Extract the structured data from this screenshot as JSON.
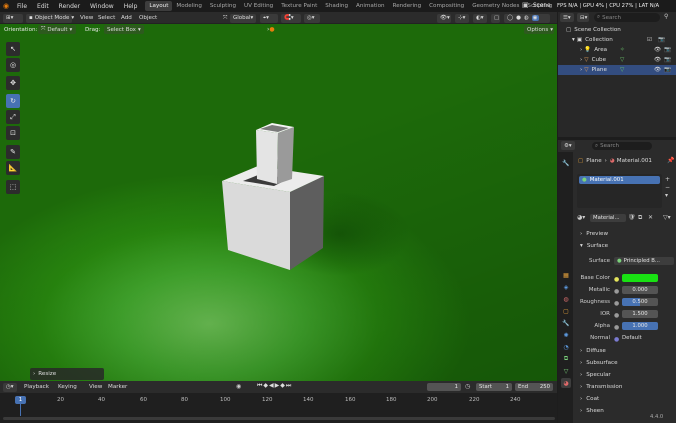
{
  "menu": [
    "File",
    "Edit",
    "Render",
    "Window",
    "Help"
  ],
  "workspaces": [
    "Layout",
    "Modeling",
    "Sculpting",
    "UV Editing",
    "Texture Paint",
    "Shading",
    "Animation",
    "Rendering",
    "Compositing",
    "Geometry Nodes",
    "Scripting"
  ],
  "active_workspace": "Layout",
  "scene_name": "Scene",
  "stats": "FPS N/A | GPU 4% | CPU 27% | LAT N/A",
  "header": {
    "mode": "Object Mode",
    "view": "View",
    "select": "Select",
    "add": "Add",
    "object": "Object",
    "transform": "Global"
  },
  "header2": {
    "orientation_label": "Orientation:",
    "orientation": "Default",
    "drag_label": "Drag:",
    "drag": "Select Box",
    "options": "Options"
  },
  "last_op": "Resize",
  "search_placeholder": "Search",
  "outliner": {
    "root": "Scene Collection",
    "collection": "Collection",
    "items": [
      {
        "name": "Area"
      },
      {
        "name": "Cube"
      },
      {
        "name": "Plane"
      }
    ]
  },
  "properties": {
    "search_placeholder": "Search",
    "breadcrumb_object": "Plane",
    "breadcrumb_material": "Material.001",
    "slot": "Material.001",
    "material_name": "Material...",
    "sections": [
      "Preview",
      "Surface"
    ],
    "surface_label": "Surface",
    "surface_value": "Principled B...",
    "base_color_label": "Base Color",
    "base_color": "#19e113",
    "metallic_label": "Metallic",
    "metallic": "0.000",
    "roughness_label": "Roughness",
    "roughness": "0.500",
    "ior_label": "IOR",
    "ior": "1.500",
    "alpha_label": "Alpha",
    "alpha": "1.000",
    "normal_label": "Normal",
    "normal": "Default",
    "subpanels": [
      "Diffuse",
      "Subsurface",
      "Specular",
      "Transmission",
      "Coat",
      "Sheen"
    ]
  },
  "timeline": {
    "playback": "Playback",
    "keying": "Keying",
    "view": "View",
    "marker": "Marker",
    "current_frame": "1",
    "start_label": "Start",
    "start": "1",
    "end_label": "End",
    "end": "250",
    "ticks": [
      "1",
      "20",
      "40",
      "60",
      "80",
      "100",
      "120",
      "140",
      "160",
      "180",
      "200",
      "220",
      "240"
    ],
    "cursor": "1"
  },
  "version": "4.4.0",
  "colors": {
    "accent": "#4772b3",
    "viewport_green": "#2a8a12"
  }
}
